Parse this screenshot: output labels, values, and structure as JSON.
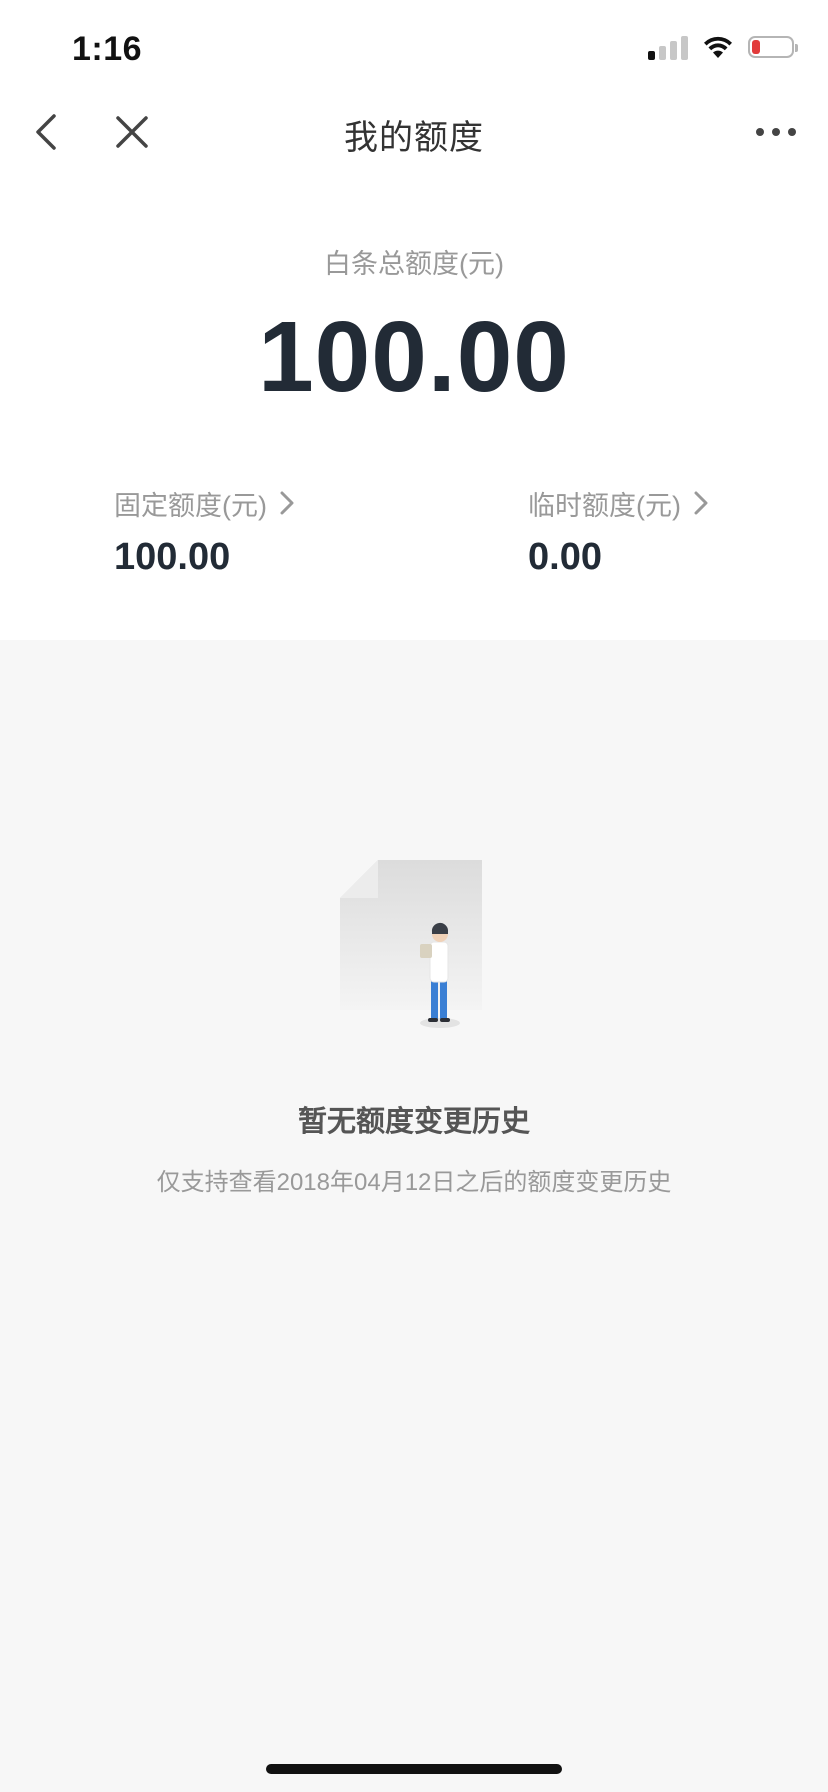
{
  "status_bar": {
    "time": "1:16",
    "battery_level": 0.2,
    "battery_color": "#e23b3b"
  },
  "nav": {
    "title": "我的额度",
    "back_icon": "chevron-left-icon",
    "close_icon": "close-icon",
    "more_icon": "more-horizontal-icon"
  },
  "credit": {
    "total_label": "白条总额度(元)",
    "total_amount": "100.00",
    "fixed": {
      "label": "固定额度(元)",
      "value": "100.00"
    },
    "temporary": {
      "label": "临时额度(元)",
      "value": "0.00"
    }
  },
  "empty_state": {
    "illustration_icon": "empty-document-person-icon",
    "title": "暂无额度变更历史",
    "description": "仅支持查看2018年04月12日之后的额度变更历史"
  },
  "colors": {
    "amount_text": "#222b36",
    "secondary_text": "#999999",
    "background": "#f7f7f7"
  }
}
